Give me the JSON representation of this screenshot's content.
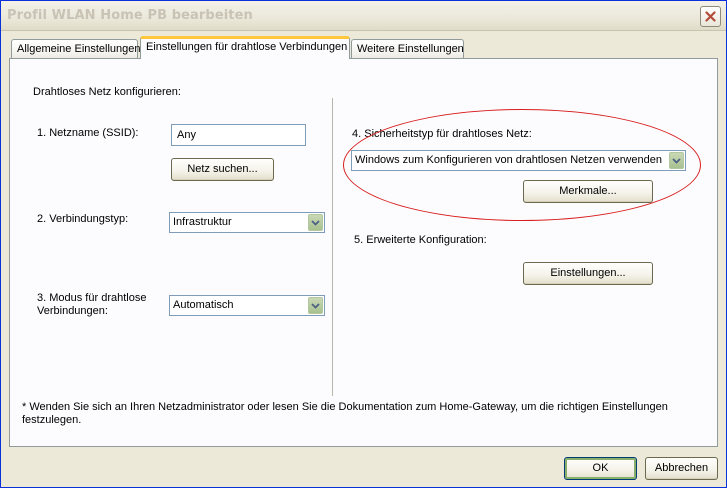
{
  "window": {
    "title": "Profil WLAN Home PB bearbeiten"
  },
  "tabs": [
    {
      "label": "Allgemeine Einstellungen",
      "active": false
    },
    {
      "label": "Einstellungen für drahtlose Verbindungen",
      "active": true
    },
    {
      "label": "Weitere Einstellungen",
      "active": false
    }
  ],
  "panel": {
    "section_heading": "Drahtloses Netz konfigurieren:",
    "ssid": {
      "label": "1. Netzname (SSID):",
      "value": "Any",
      "search_button": "Netz suchen..."
    },
    "connection_type": {
      "label": "2. Verbindungstyp:",
      "value": "Infrastruktur"
    },
    "mode": {
      "label_line1": "3. Modus für drahtlose",
      "label_line2": "Verbindungen:",
      "value": "Automatisch"
    },
    "security": {
      "label": "4. Sicherheitstyp für drahtloses Netz:",
      "value": "Windows zum Konfigurieren von drahtlosen Netzen verwenden",
      "properties_button": "Merkmale..."
    },
    "advanced": {
      "label": "5. Erweiterte Konfiguration:",
      "settings_button": "Einstellungen..."
    },
    "footnote_line1": "* Wenden Sie sich an Ihren Netzadministrator oder lesen Sie die Dokumentation zum Home-Gateway, um die richtigen Einstellungen",
    "footnote_line2": "festzulegen."
  },
  "footer": {
    "ok": "OK",
    "cancel": "Abbrechen"
  },
  "annotation": {
    "color": "#d81e1e",
    "shape": "ellipse-highlight"
  },
  "colors": {
    "tab_highlight": "#ffc83c",
    "panel_bg": "#fcfcfe",
    "dialog_bg": "#ece9d8"
  }
}
